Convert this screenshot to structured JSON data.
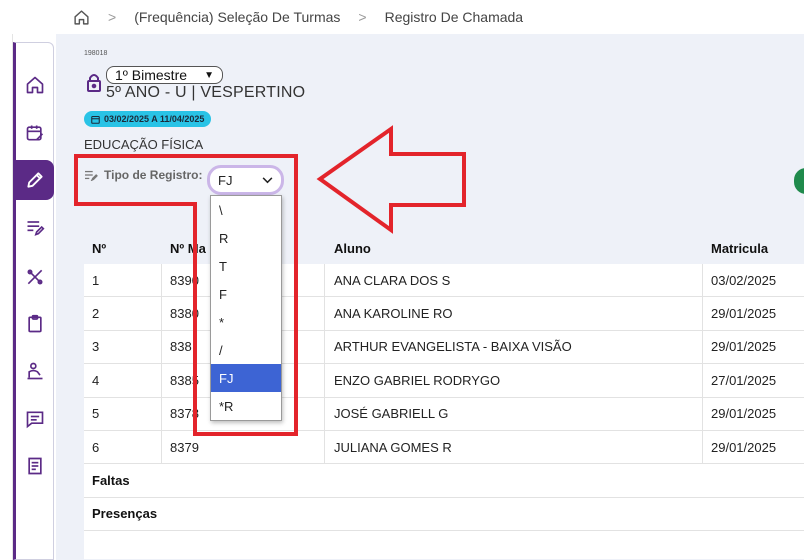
{
  "breadcrumb": {
    "items": [
      "(Frequência) Seleção De Turmas",
      "Registro De Chamada"
    ],
    "separator": ">"
  },
  "header": {
    "code": "198018",
    "bimestre": "1º Bimestre",
    "turma": "5º ANO - U | VESPERTINO",
    "period": "03/02/2025 A 11/04/2025",
    "disciplina": "EDUCAÇÃO FÍSICA"
  },
  "tipo_registro": {
    "label": "Tipo de Registro:",
    "value": "FJ",
    "options": [
      "\\",
      "R",
      "T",
      "F",
      "*",
      "/",
      "FJ",
      "*R"
    ],
    "selected_index": 6
  },
  "table": {
    "headers": [
      "Nº",
      "Nº Ma",
      "Aluno",
      "Matricula"
    ],
    "rows": [
      {
        "n": "1",
        "num": "8390",
        "aluno": "ANA CLARA DOS S",
        "matricula": "03/02/2025"
      },
      {
        "n": "2",
        "num": "8380",
        "aluno": "ANA KAROLINE RO",
        "matricula": "29/01/2025"
      },
      {
        "n": "3",
        "num": "838",
        "aluno": "ARTHUR EVANGELISTA - BAIXA VISÃO",
        "matricula": "29/01/2025"
      },
      {
        "n": "4",
        "num": "8385",
        "aluno": "ENZO GABRIEL RODRYGO",
        "matricula": "27/01/2025"
      },
      {
        "n": "5",
        "num": "8378",
        "aluno": "JOSÉ GABRIELL G",
        "matricula": "29/01/2025"
      },
      {
        "n": "6",
        "num": "8379",
        "aluno": "JULIANA GOMES R",
        "matricula": "29/01/2025"
      }
    ],
    "summary": [
      "Faltas",
      "Presenças"
    ]
  },
  "colors": {
    "brand_purple": "#5b2a86",
    "period_badge": "#29c3e6",
    "selected_option": "#3d64d4",
    "annotation_red": "#e3242b"
  },
  "sidebar_icons": [
    "home-icon",
    "calendar-edit-icon",
    "pencil-icon",
    "list-edit-icon",
    "tools-icon",
    "clipboard-icon",
    "reader-icon",
    "chat-icon",
    "document-icon"
  ]
}
